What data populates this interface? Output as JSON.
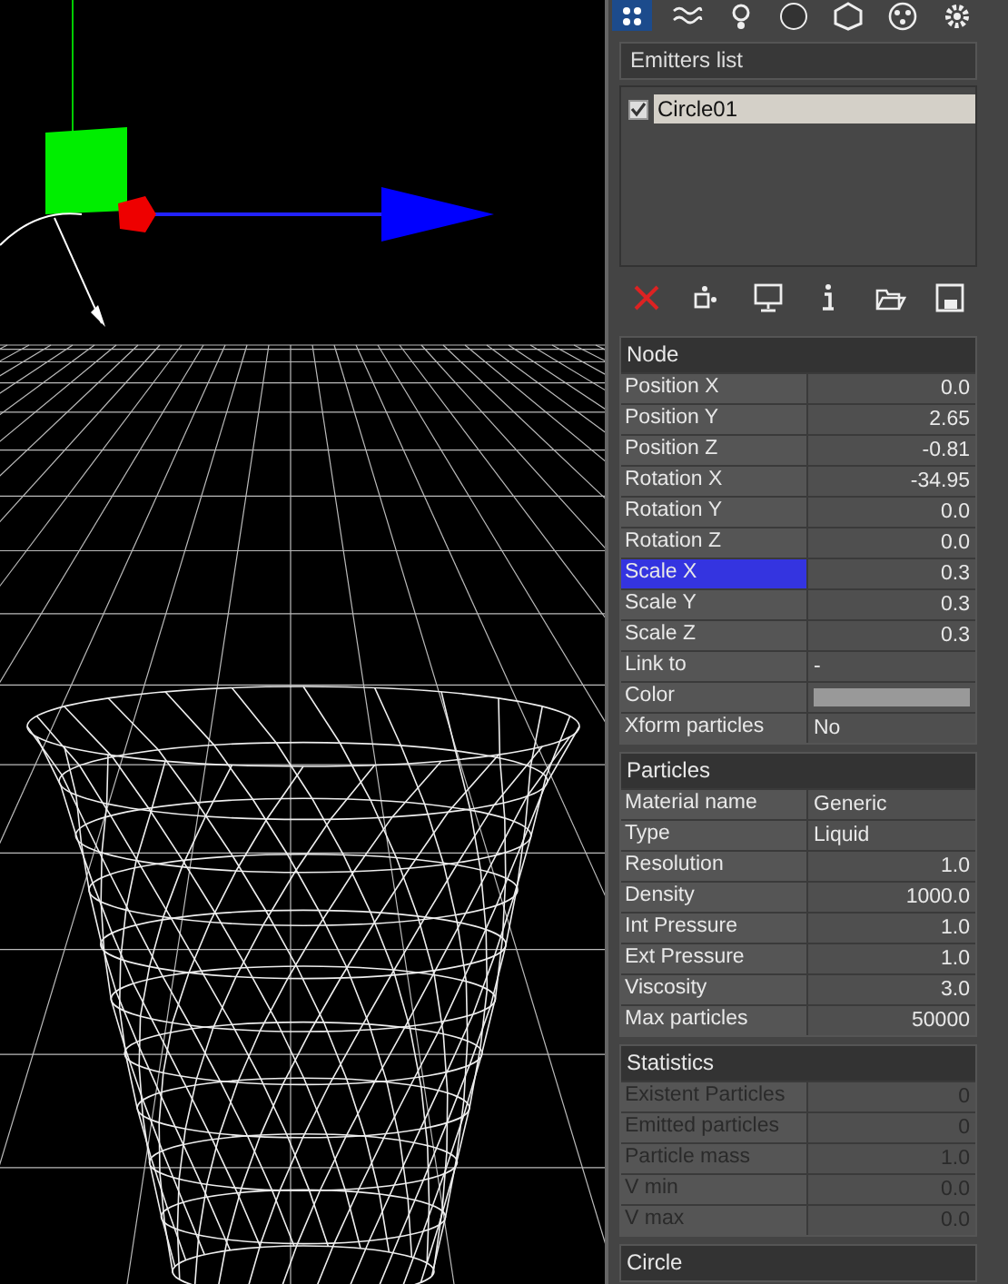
{
  "toolbar_tabs": [
    {
      "kind": "particles",
      "selected": true
    },
    {
      "kind": "waves",
      "selected": false
    },
    {
      "kind": "emitter",
      "selected": false
    },
    {
      "kind": "sphere",
      "selected": false
    },
    {
      "kind": "hexagon",
      "selected": false
    },
    {
      "kind": "dots",
      "selected": false
    },
    {
      "kind": "gear",
      "selected": false
    }
  ],
  "emitters": {
    "title": "Emitters list",
    "items": [
      {
        "name": "Circle01",
        "checked": true,
        "selected": true
      }
    ]
  },
  "actions": [
    {
      "kind": "delete"
    },
    {
      "kind": "add"
    },
    {
      "kind": "monitor"
    },
    {
      "kind": "info"
    },
    {
      "kind": "open"
    },
    {
      "kind": "save"
    }
  ],
  "sections": [
    {
      "title": "Node",
      "rows": [
        {
          "label": "Position X",
          "value": "0.0",
          "kind": "number",
          "selected": false,
          "disabled": false
        },
        {
          "label": "Position Y",
          "value": "2.65",
          "kind": "number",
          "selected": false,
          "disabled": false
        },
        {
          "label": "Position Z",
          "value": "-0.81",
          "kind": "number",
          "selected": false,
          "disabled": false
        },
        {
          "label": "Rotation X",
          "value": "-34.95",
          "kind": "number",
          "selected": false,
          "disabled": false
        },
        {
          "label": "Rotation Y",
          "value": "0.0",
          "kind": "number",
          "selected": false,
          "disabled": false
        },
        {
          "label": "Rotation Z",
          "value": "0.0",
          "kind": "number",
          "selected": false,
          "disabled": false
        },
        {
          "label": "Scale X",
          "value": "0.3",
          "kind": "number",
          "selected": true,
          "disabled": false
        },
        {
          "label": "Scale Y",
          "value": "0.3",
          "kind": "number",
          "selected": false,
          "disabled": false
        },
        {
          "label": "Scale Z",
          "value": "0.3",
          "kind": "number",
          "selected": false,
          "disabled": false
        },
        {
          "label": "Link to",
          "value": "-",
          "kind": "text",
          "selected": false,
          "disabled": false
        },
        {
          "label": "Color",
          "kind": "color",
          "color": "#999999",
          "selected": false,
          "disabled": false
        },
        {
          "label": "Xform particles",
          "value": "No",
          "kind": "text",
          "selected": false,
          "disabled": false
        }
      ]
    },
    {
      "title": "Particles",
      "rows": [
        {
          "label": "Material name",
          "value": "Generic",
          "kind": "text",
          "selected": false,
          "disabled": false
        },
        {
          "label": "Type",
          "value": "Liquid",
          "kind": "text",
          "selected": false,
          "disabled": false
        },
        {
          "label": "Resolution",
          "value": "1.0",
          "kind": "number",
          "selected": false,
          "disabled": false
        },
        {
          "label": "Density",
          "value": "1000.0",
          "kind": "number",
          "selected": false,
          "disabled": false
        },
        {
          "label": "Int Pressure",
          "value": "1.0",
          "kind": "number",
          "selected": false,
          "disabled": false
        },
        {
          "label": "Ext Pressure",
          "value": "1.0",
          "kind": "number",
          "selected": false,
          "disabled": false
        },
        {
          "label": "Viscosity",
          "value": "3.0",
          "kind": "number",
          "selected": false,
          "disabled": false
        },
        {
          "label": "Max particles",
          "value": "50000",
          "kind": "number",
          "selected": false,
          "disabled": false
        }
      ]
    },
    {
      "title": "Statistics",
      "rows": [
        {
          "label": "Existent Particles",
          "value": "0",
          "kind": "number",
          "selected": false,
          "disabled": true
        },
        {
          "label": "Emitted particles",
          "value": "0",
          "kind": "number",
          "selected": false,
          "disabled": true
        },
        {
          "label": "Particle mass",
          "value": "1.0",
          "kind": "number",
          "selected": false,
          "disabled": true
        },
        {
          "label": "V min",
          "value": "0.0",
          "kind": "number",
          "selected": false,
          "disabled": true
        },
        {
          "label": "V max",
          "value": "0.0",
          "kind": "number",
          "selected": false,
          "disabled": true
        }
      ]
    },
    {
      "title": "Circle"
    }
  ]
}
